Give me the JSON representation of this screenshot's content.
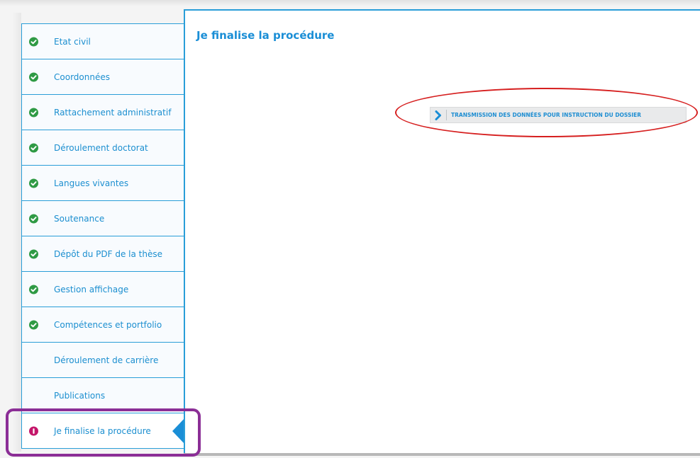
{
  "sidebar": {
    "items": [
      {
        "label": "Etat civil",
        "status": "complete"
      },
      {
        "label": "Coordonnées",
        "status": "complete"
      },
      {
        "label": "Rattachement administratif",
        "status": "complete"
      },
      {
        "label": "Déroulement doctorat",
        "status": "complete"
      },
      {
        "label": "Langues vivantes",
        "status": "complete"
      },
      {
        "label": "Soutenance",
        "status": "complete"
      },
      {
        "label": "Dépôt du PDF de la thèse",
        "status": "complete"
      },
      {
        "label": "Gestion affichage",
        "status": "complete"
      },
      {
        "label": "Compétences et portfolio",
        "status": "complete"
      },
      {
        "label": "Déroulement de carrière",
        "status": "none"
      },
      {
        "label": "Publications",
        "status": "none"
      },
      {
        "label": "Je finalise la procédure",
        "status": "alert",
        "active": true
      }
    ]
  },
  "main": {
    "title": "Je finalise la procédure",
    "submit_button_label": "TRANSMISSION DES DONNÉES POUR INSTRUCTION DU DOSSIER",
    "submit_button_icon": "chevron-right-icon"
  },
  "colors": {
    "accent": "#1a8ed6",
    "border": "#2a9ed8",
    "complete_icon": "#2f9a44",
    "alert_icon": "#c4166a",
    "annotation_red": "#d61f1f",
    "annotation_purple": "#8b2e96"
  }
}
